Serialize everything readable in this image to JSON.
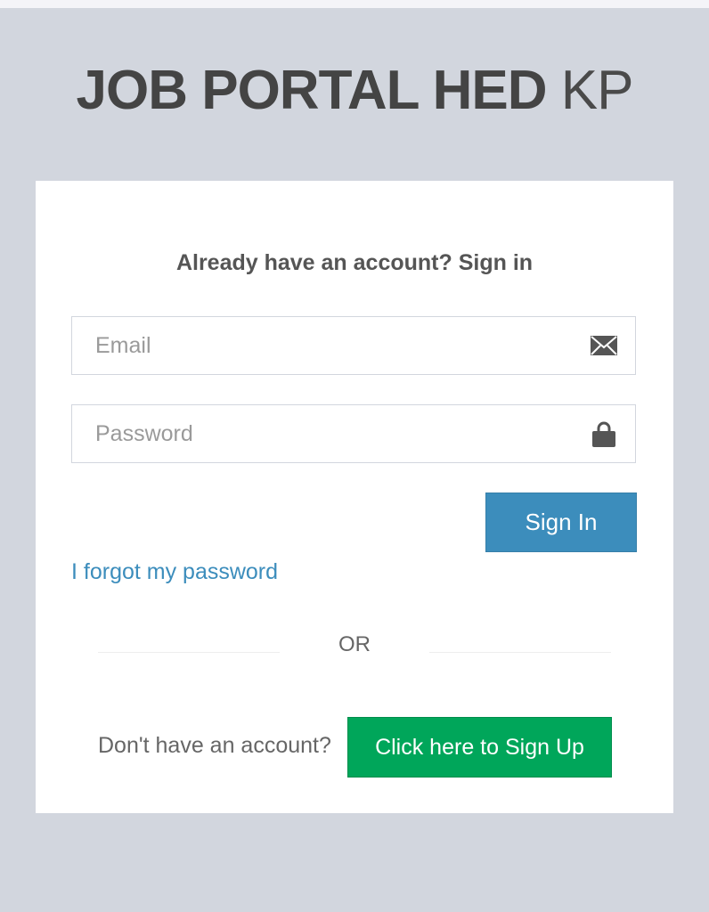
{
  "logo": {
    "bold_text": "JOB PORTAL HED",
    "light_text": "KP"
  },
  "login_box": {
    "title": "Already have an account? Sign in",
    "email": {
      "placeholder": "Email",
      "value": "",
      "icon": "envelope-icon"
    },
    "password": {
      "placeholder": "Password",
      "value": "",
      "icon": "lock-icon"
    },
    "signin_label": "Sign In",
    "forgot_label": "I forgot my password",
    "or_label": "OR",
    "no_account_label": "Don't have an account?",
    "signup_label": "Click here to Sign Up"
  },
  "colors": {
    "background": "#d2d6de",
    "card": "#ffffff",
    "primary": "#3c8dbc",
    "success": "#00a65a",
    "icon": "#555555"
  }
}
